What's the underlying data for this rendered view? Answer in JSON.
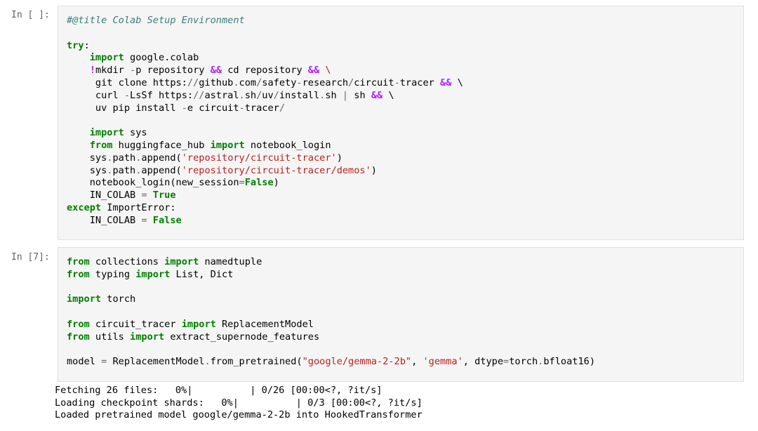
{
  "cells": [
    {
      "prompt": "In [ ]:",
      "lines": [
        [
          {
            "t": "#@title Colab Setup Environment",
            "c": "cm"
          }
        ],
        [],
        [
          {
            "t": "try",
            "c": "kw"
          },
          {
            "t": ":",
            "c": ""
          }
        ],
        [
          {
            "t": "    ",
            "c": ""
          },
          {
            "t": "import",
            "c": "kw"
          },
          {
            "t": " google.colab",
            "c": ""
          }
        ],
        [
          {
            "t": "    ",
            "c": ""
          },
          {
            "t": "!",
            "c": "op"
          },
          {
            "t": "mkdir ",
            "c": ""
          },
          {
            "t": "-",
            "c": "opn"
          },
          {
            "t": "p repository ",
            "c": ""
          },
          {
            "t": "&&",
            "c": "op"
          },
          {
            "t": " cd repository ",
            "c": ""
          },
          {
            "t": "&&",
            "c": "op"
          },
          {
            "t": " ",
            "c": ""
          },
          {
            "t": "\\",
            "c": "str"
          }
        ],
        [
          {
            "t": "     git clone https:",
            "c": ""
          },
          {
            "t": "//",
            "c": "opn"
          },
          {
            "t": "github",
            "c": ""
          },
          {
            "t": ".",
            "c": "opn"
          },
          {
            "t": "com",
            "c": ""
          },
          {
            "t": "/",
            "c": "opn"
          },
          {
            "t": "safety",
            "c": ""
          },
          {
            "t": "-",
            "c": "opn"
          },
          {
            "t": "research",
            "c": ""
          },
          {
            "t": "/",
            "c": "opn"
          },
          {
            "t": "circuit",
            "c": ""
          },
          {
            "t": "-",
            "c": "opn"
          },
          {
            "t": "tracer ",
            "c": ""
          },
          {
            "t": "&&",
            "c": "op"
          },
          {
            "t": " \\",
            "c": ""
          }
        ],
        [
          {
            "t": "     curl ",
            "c": ""
          },
          {
            "t": "-",
            "c": "opn"
          },
          {
            "t": "LsSf https:",
            "c": ""
          },
          {
            "t": "//",
            "c": "opn"
          },
          {
            "t": "astral",
            "c": ""
          },
          {
            "t": ".",
            "c": "opn"
          },
          {
            "t": "sh",
            "c": ""
          },
          {
            "t": "/",
            "c": "opn"
          },
          {
            "t": "uv",
            "c": ""
          },
          {
            "t": "/",
            "c": "opn"
          },
          {
            "t": "install",
            "c": ""
          },
          {
            "t": ".",
            "c": "opn"
          },
          {
            "t": "sh ",
            "c": ""
          },
          {
            "t": "|",
            "c": "opn"
          },
          {
            "t": " sh ",
            "c": ""
          },
          {
            "t": "&&",
            "c": "op"
          },
          {
            "t": " \\",
            "c": ""
          }
        ],
        [
          {
            "t": "     uv pip install ",
            "c": ""
          },
          {
            "t": "-",
            "c": "opn"
          },
          {
            "t": "e circuit",
            "c": ""
          },
          {
            "t": "-",
            "c": "opn"
          },
          {
            "t": "tracer",
            "c": ""
          },
          {
            "t": "/",
            "c": "opn"
          }
        ],
        [],
        [
          {
            "t": "    ",
            "c": ""
          },
          {
            "t": "import",
            "c": "kw"
          },
          {
            "t": " sys",
            "c": ""
          }
        ],
        [
          {
            "t": "    ",
            "c": ""
          },
          {
            "t": "from",
            "c": "kw"
          },
          {
            "t": " huggingface_hub ",
            "c": ""
          },
          {
            "t": "import",
            "c": "kw"
          },
          {
            "t": " notebook_login",
            "c": ""
          }
        ],
        [
          {
            "t": "    sys",
            "c": ""
          },
          {
            "t": ".",
            "c": "opn"
          },
          {
            "t": "path",
            "c": ""
          },
          {
            "t": ".",
            "c": "opn"
          },
          {
            "t": "append(",
            "c": ""
          },
          {
            "t": "'repository/circuit-tracer'",
            "c": "str"
          },
          {
            "t": ")",
            "c": ""
          }
        ],
        [
          {
            "t": "    sys",
            "c": ""
          },
          {
            "t": ".",
            "c": "opn"
          },
          {
            "t": "path",
            "c": ""
          },
          {
            "t": ".",
            "c": "opn"
          },
          {
            "t": "append(",
            "c": ""
          },
          {
            "t": "'repository/circuit-tracer/demos'",
            "c": "str"
          },
          {
            "t": ")",
            "c": ""
          }
        ],
        [
          {
            "t": "    notebook_login(new_session",
            "c": ""
          },
          {
            "t": "=",
            "c": "opn"
          },
          {
            "t": "False",
            "c": "kw"
          },
          {
            "t": ")",
            "c": ""
          }
        ],
        [
          {
            "t": "    IN_COLAB ",
            "c": ""
          },
          {
            "t": "=",
            "c": "opn"
          },
          {
            "t": " ",
            "c": ""
          },
          {
            "t": "True",
            "c": "kw"
          }
        ],
        [
          {
            "t": "except",
            "c": "kw"
          },
          {
            "t": " ImportError:",
            "c": ""
          }
        ],
        [
          {
            "t": "    IN_COLAB ",
            "c": ""
          },
          {
            "t": "=",
            "c": "opn"
          },
          {
            "t": " ",
            "c": ""
          },
          {
            "t": "False",
            "c": "kw"
          }
        ]
      ],
      "output": []
    },
    {
      "prompt": "In [7]:",
      "lines": [
        [
          {
            "t": "from",
            "c": "kw"
          },
          {
            "t": " collections ",
            "c": ""
          },
          {
            "t": "import",
            "c": "kw"
          },
          {
            "t": " namedtuple",
            "c": ""
          }
        ],
        [
          {
            "t": "from",
            "c": "kw"
          },
          {
            "t": " typing ",
            "c": ""
          },
          {
            "t": "import",
            "c": "kw"
          },
          {
            "t": " List, Dict",
            "c": ""
          }
        ],
        [],
        [
          {
            "t": "import",
            "c": "kw"
          },
          {
            "t": " torch",
            "c": ""
          }
        ],
        [],
        [
          {
            "t": "from",
            "c": "kw"
          },
          {
            "t": " circuit_tracer ",
            "c": ""
          },
          {
            "t": "import",
            "c": "kw"
          },
          {
            "t": " ReplacementModel",
            "c": ""
          }
        ],
        [
          {
            "t": "from",
            "c": "kw"
          },
          {
            "t": " utils ",
            "c": ""
          },
          {
            "t": "import",
            "c": "kw"
          },
          {
            "t": " extract_supernode_features",
            "c": ""
          }
        ],
        [],
        [
          {
            "t": "model ",
            "c": ""
          },
          {
            "t": "=",
            "c": "opn"
          },
          {
            "t": " ReplacementModel",
            "c": ""
          },
          {
            "t": ".",
            "c": "opn"
          },
          {
            "t": "from_pretrained(",
            "c": ""
          },
          {
            "t": "\"google/gemma-2-2b\"",
            "c": "str"
          },
          {
            "t": ", ",
            "c": ""
          },
          {
            "t": "'gemma'",
            "c": "str"
          },
          {
            "t": ", dtype",
            "c": ""
          },
          {
            "t": "=",
            "c": "opn"
          },
          {
            "t": "torch",
            "c": ""
          },
          {
            "t": ".",
            "c": "opn"
          },
          {
            "t": "bfloat16)",
            "c": ""
          }
        ]
      ],
      "output": [
        "Fetching 26 files:   0%|          | 0/26 [00:00<?, ?it/s]",
        "Loading checkpoint shards:   0%|          | 0/3 [00:00<?, ?it/s]",
        "Loaded pretrained model google/gemma-2-2b into HookedTransformer"
      ]
    }
  ]
}
